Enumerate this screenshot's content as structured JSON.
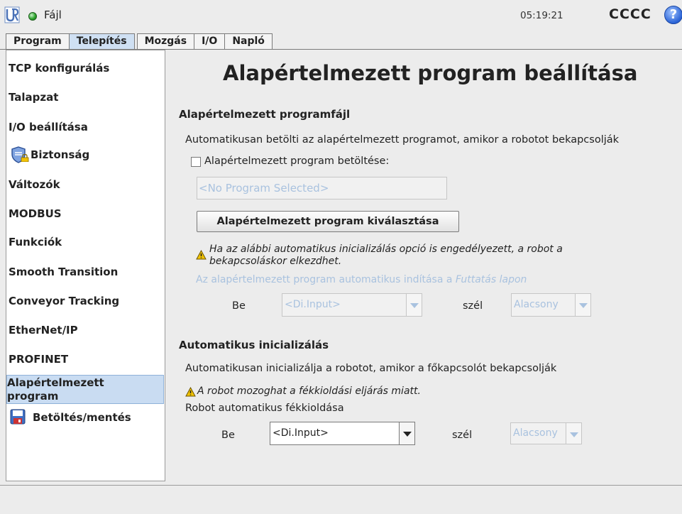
{
  "header": {
    "file_menu": "Fájl",
    "clock": "05:19:21",
    "robot_name": "CCCC",
    "help_symbol": "?"
  },
  "tabs": [
    {
      "label": "Program",
      "active": false
    },
    {
      "label": "Telepítés",
      "active": true
    },
    {
      "label": "Mozgás",
      "active": false
    },
    {
      "label": "I/O",
      "active": false
    },
    {
      "label": "Napló",
      "active": false
    }
  ],
  "sidebar": {
    "items": [
      {
        "label": "TCP konfigurálás"
      },
      {
        "label": "Talapzat"
      },
      {
        "label": "I/O beállítása"
      },
      {
        "label": "Biztonság",
        "icon": "shield-lock-icon"
      },
      {
        "label": "Változók"
      },
      {
        "label": "MODBUS"
      },
      {
        "label": "Funkciók"
      },
      {
        "label": "Smooth Transition"
      },
      {
        "label": "Conveyor Tracking"
      },
      {
        "label": "EtherNet/IP"
      },
      {
        "label": "PROFINET"
      },
      {
        "label": "Alapértelmezett program",
        "selected": true
      },
      {
        "label": "Betöltés/mentés",
        "icon": "floppy-disk-icon"
      }
    ]
  },
  "main": {
    "title": "Alapértelmezett program beállítása",
    "default_file": {
      "heading": "Alapértelmezett programfájl",
      "description": "Automatikusan betölti az alapértelmezett programot, amikor a robotot bekapcsolják",
      "checkbox_label": "Alapértelmezett program betöltése:",
      "checkbox_checked": false,
      "program_field": "<No Program Selected>",
      "select_button": "Alapértelmezett program kiválasztása",
      "warning_line1": "Ha az alábbi automatikus inicializálás opció is engedélyezett, a robot a",
      "warning_line2": "bekapcsoláskor elkezdhet.",
      "autostart_text": "Az alapértelmezett program automatikus indítása a ",
      "autostart_link": "Futtatás lapon",
      "be_label": "Be",
      "input_value": "<Di.Input>",
      "edge_label": "szél",
      "edge_value": "Alacsony"
    },
    "auto_init": {
      "heading": "Automatikus inicializálás",
      "description": "Automatikusan inicializálja a robotot, amikor a főkapcsolót bekapcsolják",
      "warning": "A robot mozoghat a fékkioldási eljárás miatt.",
      "brake_label": "Robot automatikus fékkioldása",
      "be_label": "Be",
      "input_value": "<Di.Input>",
      "edge_label": "szél",
      "edge_value": "Alacsony"
    }
  },
  "colors": {
    "selected": "#c9dcf2",
    "disabled_text": "#a9c2df",
    "status_green": "#2da52d",
    "warning_yellow": "#f2c300"
  }
}
